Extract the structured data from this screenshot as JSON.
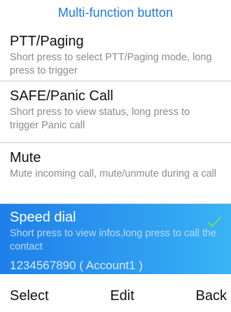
{
  "header": {
    "title": "Multi-function button"
  },
  "items": [
    {
      "title": "PTT/Paging",
      "description": "Short press to select PTT/Paging mode, long press to trigger"
    },
    {
      "title": "SAFE/Panic Call",
      "description": "Short press to view status, long press to trigger Panic call"
    },
    {
      "title": "Mute",
      "description": "Mute incoming call, mute/unmute during a call"
    },
    {
      "title": "Speed dial",
      "description": "Short press to view infos,long press to call the contact",
      "value": "1234567890 ( Account1 )",
      "selected": true,
      "selected_icon": "check-icon"
    }
  ],
  "softkeys": {
    "left": "Select",
    "center": "Edit",
    "right": "Back"
  },
  "colors": {
    "header_text": "#1e78e6",
    "highlight_start": "#1f7fe9",
    "highlight_end": "#39b4f5",
    "check": "#7ed957",
    "description_text": "#8c8c8c"
  }
}
